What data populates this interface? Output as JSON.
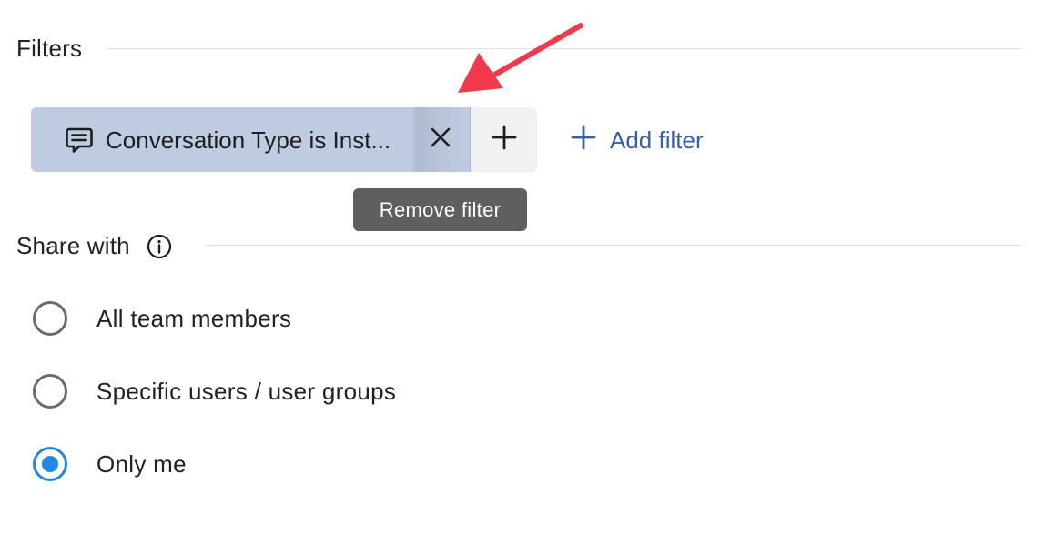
{
  "filters": {
    "title": "Filters",
    "chip": {
      "icon": "chat-bubble-icon",
      "label": "Conversation Type is Inst...",
      "remove_icon": "close-icon",
      "add_icon": "plus-icon"
    },
    "add_filter_label": "Add filter",
    "tooltip": "Remove filter"
  },
  "share": {
    "title": "Share with",
    "info_icon": "info-icon",
    "options": [
      {
        "label": "All team members",
        "selected": false
      },
      {
        "label": "Specific users / user groups",
        "selected": false
      },
      {
        "label": "Only me",
        "selected": true
      }
    ]
  },
  "colors": {
    "chip_bg": "#bfcbe0",
    "link_blue": "#2f5fae",
    "radio_selected": "#1e88e5",
    "annotation_red": "#f2384a",
    "tooltip_bg": "#5f5f5f"
  }
}
